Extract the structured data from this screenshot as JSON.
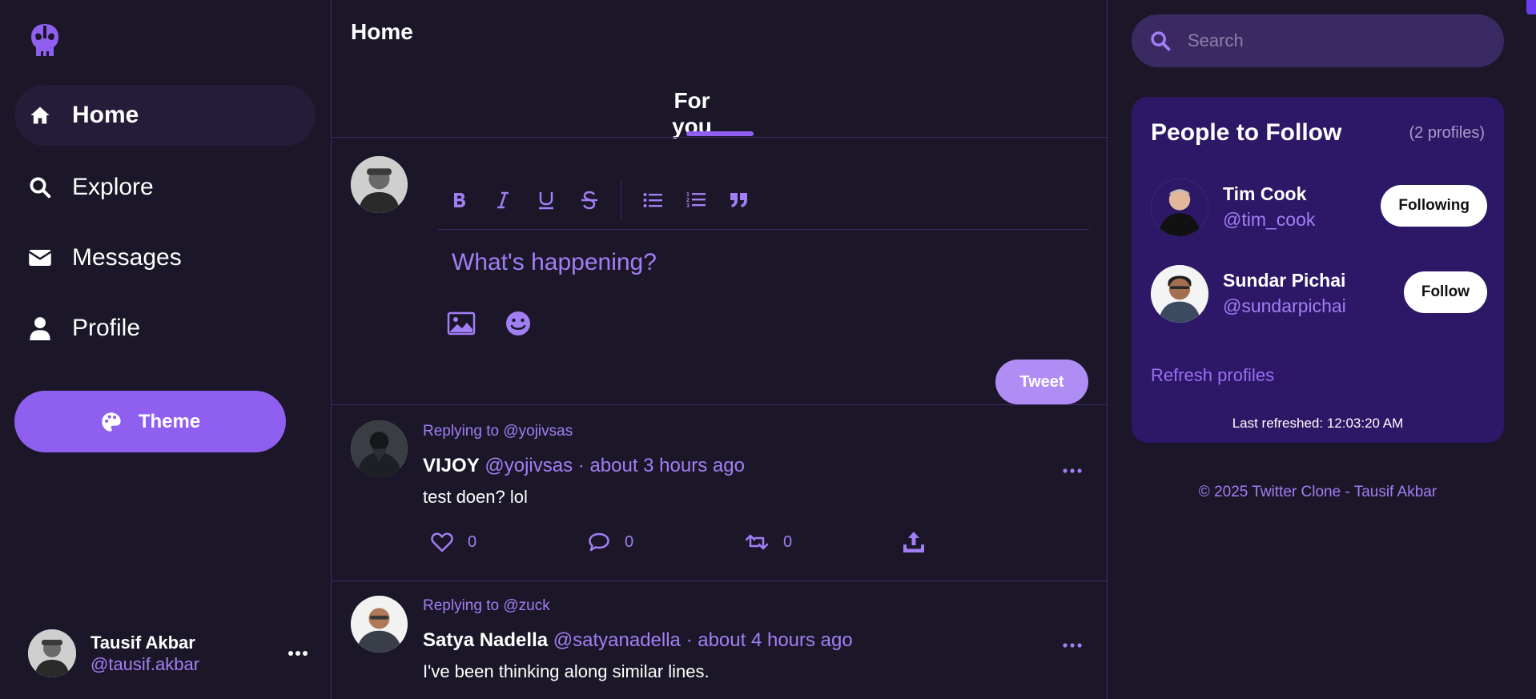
{
  "sidebar": {
    "logo_icon": "skull-logo-icon",
    "nav": [
      {
        "label": "Home",
        "icon": "home-icon",
        "active": true
      },
      {
        "label": "Explore",
        "icon": "search-icon"
      },
      {
        "label": "Messages",
        "icon": "envelope-icon"
      },
      {
        "label": "Profile",
        "icon": "user-icon"
      }
    ],
    "theme_label": "Theme",
    "user": {
      "name": "Tausif Akbar",
      "handle": "@tausif.akbar"
    }
  },
  "main": {
    "title": "Home",
    "tab": "For you",
    "composer": {
      "placeholder": "What's happening?",
      "toolbar": [
        "bold",
        "italic",
        "underline",
        "strikethrough",
        "bullet-list",
        "numbered-list",
        "quote"
      ],
      "tweet_label": "Tweet"
    },
    "posts": [
      {
        "replying_prefix": "Replying to",
        "replying_handle": "@yojivsas",
        "name": "VIJOY",
        "handle": "@yojivsas",
        "time": "· about 3 hours ago",
        "text": "test doen? lol",
        "likes": "0",
        "comments": "0",
        "retweets": "0"
      },
      {
        "replying_prefix": "Replying to",
        "replying_handle": "@zuck",
        "name": "Satya Nadella",
        "handle": "@satyanadella",
        "time": "· about 4 hours ago",
        "text": "I've been thinking along similar lines."
      }
    ]
  },
  "right": {
    "search_placeholder": "Search",
    "people": {
      "title": "People to Follow",
      "count": "(2 profiles)",
      "list": [
        {
          "name": "Tim Cook",
          "handle": "@tim_cook",
          "button": "Following"
        },
        {
          "name": "Sundar Pichai",
          "handle": "@sundarpichai",
          "button": "Follow"
        }
      ],
      "refresh": "Refresh profiles",
      "last_refreshed": "Last refreshed: 12:03:20 AM"
    },
    "footer": "© 2025 Twitter Clone - Tausif Akbar"
  },
  "colors": {
    "background": "#1b1728",
    "accent": "#8f5ff0",
    "accent_text": "#a27ef5",
    "card": "#2c1866",
    "border": "#3b2a68"
  }
}
